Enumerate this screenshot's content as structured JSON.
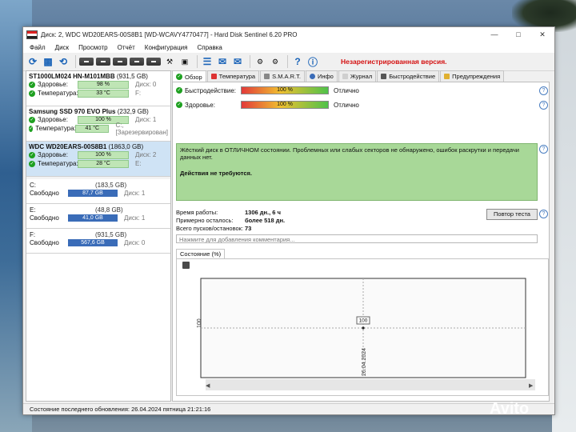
{
  "window": {
    "title": "Диск: 2, WDC WD20EARS-00S8B1 [WD-WCAVY4770477]  -  Hard Disk Sentinel 6.20 PRO"
  },
  "menu": [
    "Файл",
    "Диск",
    "Просмотр",
    "Отчёт",
    "Конфигурация",
    "Справка"
  ],
  "toolbar": {
    "unregistered": "Незарегистрированная версия."
  },
  "disks": [
    {
      "name": "ST1000LM024 HN-M101MBB",
      "size": "(931,5 GB)",
      "health_label": "Здоровье:",
      "health": "98 %",
      "health_extra": "Диск: 0",
      "temp_label": "Температура:",
      "temp": "33 °C",
      "temp_extra": "F:"
    },
    {
      "name": "Samsung SSD 970 EVO Plus",
      "size": "(232,9 GB)",
      "health_label": "Здоровье:",
      "health": "100 %",
      "health_extra": "Диск: 1",
      "temp_label": "Температура:",
      "temp": "41 °C",
      "temp_extra": "C:, [Зарезервирован]"
    },
    {
      "name": "WDC WD20EARS-00S8B1",
      "size": "(1863,0 GB)",
      "health_label": "Здоровье:",
      "health": "100 %",
      "health_extra": "Диск: 2",
      "temp_label": "Температура:",
      "temp": "28 °C",
      "temp_extra": "E:"
    }
  ],
  "volumes": [
    {
      "letter": "C:",
      "size": "(183,5 GB)",
      "free_label": "Свободно",
      "free": "87,7 GB",
      "disk": "Диск: 1"
    },
    {
      "letter": "E:",
      "size": "(48,8 GB)",
      "free_label": "Свободно",
      "free": "41,0 GB",
      "disk": "Диск: 1"
    },
    {
      "letter": "F:",
      "size": "(931,5 GB)",
      "free_label": "Свободно",
      "free": "567,6 GB",
      "disk": "Диск: 0"
    }
  ],
  "tabs": [
    "Обзор",
    "Температура",
    "S.M.A.R.T.",
    "Инфо",
    "Журнал",
    "Быстродействие",
    "Предупреждения"
  ],
  "overview": {
    "performance_label": "Быстродействие:",
    "performance_value": "100 %",
    "performance_text": "Отлично",
    "health_label": "Здоровье:",
    "health_value": "100 %",
    "health_text": "Отлично",
    "message_line1": "Жёсткий диск в ОТЛИЧНОМ состоянии. Проблемных или слабых секторов не обнаружено, ошибок раскрутки и передачи данных нет.",
    "message_line2": "Действия не требуются.",
    "uptime_label": "Время работы:",
    "uptime": "1306 дн., 6 ч",
    "remaining_label": "Примерно осталось:",
    "remaining": "более 518 дн.",
    "starts_label": "Всего пусков/остановок:",
    "starts": "73",
    "retest_button": "Повтор теста",
    "comment_placeholder": "Нажмите для добавления комментария..."
  },
  "chart_tab": "Состояние (%)",
  "chart_data": {
    "type": "scatter",
    "x": [
      "26.04.2024"
    ],
    "values": [
      100
    ],
    "yticks": [
      "100"
    ],
    "point_label": "100"
  },
  "statusbar": "Состояние последнего обновления: 26.04.2024 пятница 21:21:16",
  "watermark": "Avito"
}
